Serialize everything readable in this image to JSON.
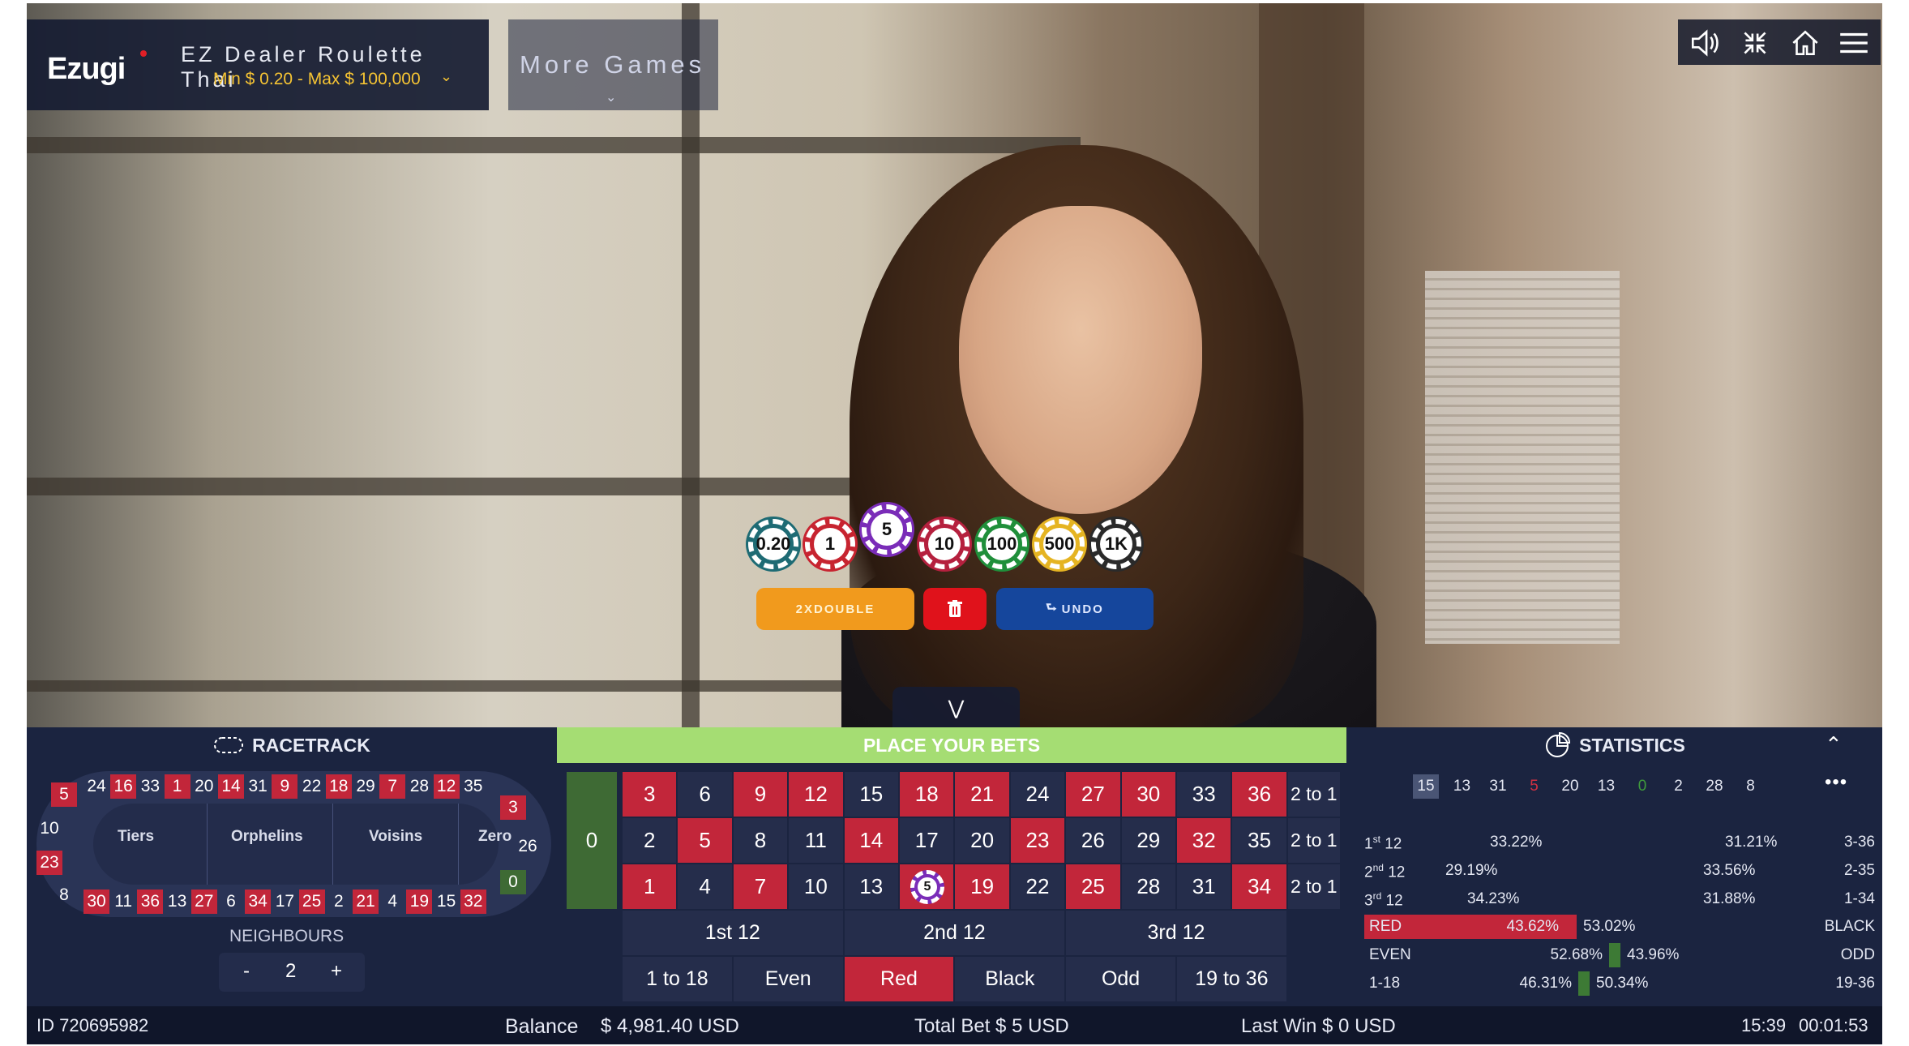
{
  "header": {
    "logo": "Ezugi",
    "game_title": "EZ Dealer Roulette Thai",
    "limits": "Min $ 0.20 - Max $ 100,000",
    "more_games": "More Games"
  },
  "top_icons": [
    "speaker-icon",
    "minimize-icon",
    "home-icon",
    "menu-icon"
  ],
  "chips": [
    {
      "label": "0.20",
      "color": "#1e6b74"
    },
    {
      "label": "1",
      "color": "#c72430"
    },
    {
      "label": "5",
      "color": "#7a2cb8"
    },
    {
      "label": "10",
      "color": "#b5203e"
    },
    {
      "label": "100",
      "color": "#1f8f3a"
    },
    {
      "label": "500",
      "color": "#e5b422"
    },
    {
      "label": "1K",
      "color": "#2a2a2a"
    }
  ],
  "selected_chip": "5",
  "actions": {
    "double": "2XDOUBLE",
    "undo": "UNDO"
  },
  "panels": {
    "racetrack": "RACETRACK",
    "place_bets": "PLACE YOUR BETS",
    "statistics": "STATISTICS"
  },
  "racetrack": {
    "top": [
      "24",
      "16",
      "33",
      "1",
      "20",
      "14",
      "31",
      "9",
      "22",
      "18",
      "29",
      "7",
      "28",
      "12",
      "35"
    ],
    "bottom": [
      "30",
      "11",
      "36",
      "13",
      "27",
      "6",
      "34",
      "17",
      "25",
      "2",
      "21",
      "4",
      "19",
      "15",
      "32"
    ],
    "left": [
      "5",
      "10",
      "23",
      "8"
    ],
    "right": [
      "3",
      "26",
      "0"
    ],
    "sections": [
      "Tiers",
      "Orphelins",
      "Voisins",
      "Zero"
    ],
    "neighbours_label": "NEIGHBOURS",
    "neighbours_value": "2",
    "minus": "-",
    "plus": "+"
  },
  "table": {
    "zero": "0",
    "rows": [
      [
        "3",
        "6",
        "9",
        "12",
        "15",
        "18",
        "21",
        "24",
        "27",
        "30",
        "33",
        "36"
      ],
      [
        "2",
        "5",
        "8",
        "11",
        "14",
        "17",
        "20",
        "23",
        "26",
        "29",
        "32",
        "35"
      ],
      [
        "1",
        "4",
        "7",
        "10",
        "13",
        "16",
        "19",
        "22",
        "25",
        "28",
        "31",
        "34"
      ]
    ],
    "red_numbers": [
      "1",
      "3",
      "5",
      "7",
      "9",
      "12",
      "14",
      "16",
      "18",
      "19",
      "21",
      "23",
      "25",
      "27",
      "30",
      "32",
      "34",
      "36"
    ],
    "column_bets": [
      "2 to 1",
      "2 to 1",
      "2 to 1"
    ],
    "dozens": [
      "1st 12",
      "2nd 12",
      "3rd 12"
    ],
    "outside": [
      "1 to 18",
      "Even",
      "Red",
      "Black",
      "Odd",
      "19 to 36"
    ],
    "bet_on": "16",
    "bet_chip": "5"
  },
  "statistics": {
    "history": [
      {
        "n": "15",
        "c": "w"
      },
      {
        "n": "13",
        "c": "w"
      },
      {
        "n": "31",
        "c": "w"
      },
      {
        "n": "5",
        "c": "r"
      },
      {
        "n": "20",
        "c": "w"
      },
      {
        "n": "13",
        "c": "w"
      },
      {
        "n": "0",
        "c": "g"
      },
      {
        "n": "2",
        "c": "w"
      },
      {
        "n": "28",
        "c": "w"
      },
      {
        "n": "8",
        "c": "w"
      }
    ],
    "more": "•••",
    "dozens_rows": [
      {
        "left": "1",
        "left_sup": "st",
        "left_suffix": " 12",
        "left_pct": "33.22%",
        "right_pct": "31.21%",
        "right": "3-36"
      },
      {
        "left": "2",
        "left_sup": "nd",
        "left_suffix": " 12",
        "left_pct": "29.19%",
        "right_pct": "33.56%",
        "right": "2-35"
      },
      {
        "left": "3",
        "left_sup": "rd",
        "left_suffix": " 12",
        "left_pct": "34.23%",
        "right_pct": "31.88%",
        "right": "1-34"
      }
    ],
    "split_rows": [
      {
        "left": "RED",
        "left_pct": "43.62%",
        "left_value": 43.62,
        "right_pct": "53.02%",
        "right": "BLACK",
        "left_color": "#c2263a"
      },
      {
        "left": "EVEN",
        "left_pct": "52.68%",
        "left_value": 52.68,
        "right_pct": "43.96%",
        "right": "ODD",
        "left_color": "#3d7a35"
      },
      {
        "left": "1-18",
        "left_pct": "46.31%",
        "left_value": 46.31,
        "right_pct": "50.34%",
        "right": "19-36",
        "left_color": "#3d7a35"
      }
    ]
  },
  "status": {
    "id": "ID 720695982",
    "balance_label": "Balance",
    "balance": "$ 4,981.40 USD",
    "total_bet": "Total Bet $ 5 USD",
    "last_win": "Last Win $ 0 USD",
    "time": "15:39",
    "elapsed": "00:01:53"
  }
}
